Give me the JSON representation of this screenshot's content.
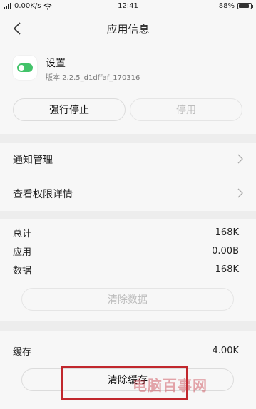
{
  "status_bar": {
    "network": "0.00K/s",
    "time": "12:41",
    "battery": "88%",
    "battery_level": 0.88
  },
  "header": {
    "title": "应用信息"
  },
  "app": {
    "name": "设置",
    "version": "版本 2.2.5_d1dffaf_170316",
    "force_stop_label": "强行停止",
    "disable_label": "停用"
  },
  "menu": [
    {
      "label": "通知管理"
    },
    {
      "label": "查看权限详情"
    }
  ],
  "storage": {
    "rows": [
      {
        "label": "总计",
        "value": "168K"
      },
      {
        "label": "应用",
        "value": "0.00B"
      },
      {
        "label": "数据",
        "value": "168K"
      }
    ],
    "clear_data_label": "清除数据"
  },
  "cache": {
    "label": "缓存",
    "value": "4.00K",
    "clear_cache_label": "清除缓存"
  },
  "watermark": "电脑百事网",
  "colors": {
    "accent_green": "#43c36a",
    "highlight_red": "#c1272d"
  }
}
